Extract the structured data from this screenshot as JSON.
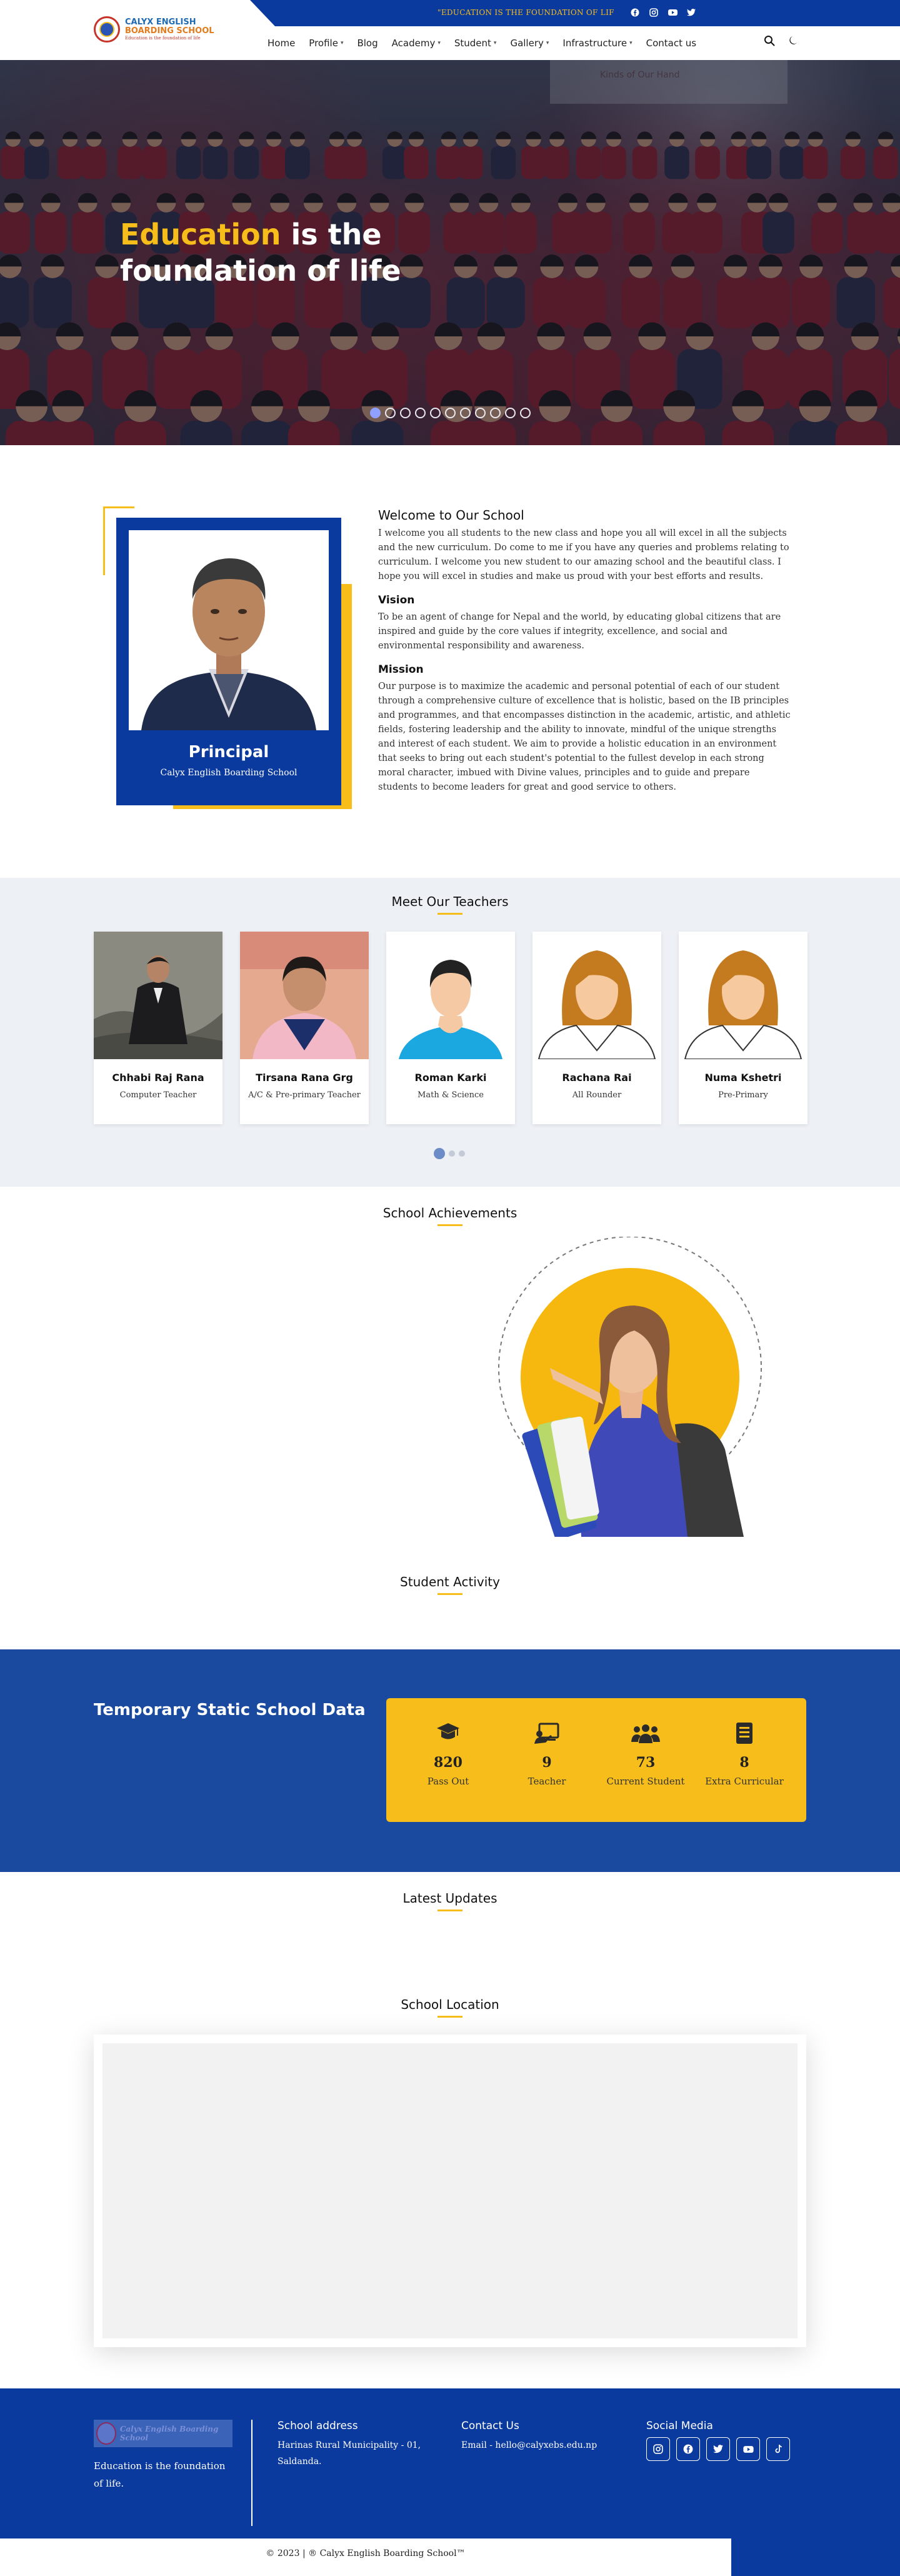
{
  "topbar": {
    "tagline": "\"EDUCATION IS THE FOUNDATION OF LIF",
    "social_icons": [
      "facebook-icon",
      "instagram-icon",
      "youtube-icon",
      "twitter-icon"
    ]
  },
  "header": {
    "logo_line1": "CALYX ENGLISH",
    "logo_line2": "BOARDING SCHOOL",
    "logo_line3": "Education is the foundation of life",
    "nav": [
      {
        "label": "Home",
        "dropdown": false
      },
      {
        "label": "Profile",
        "dropdown": true
      },
      {
        "label": "Blog",
        "dropdown": false
      },
      {
        "label": "Academy",
        "dropdown": true
      },
      {
        "label": "Student",
        "dropdown": true
      },
      {
        "label": "Gallery",
        "dropdown": true
      },
      {
        "label": "Infrastructure",
        "dropdown": true
      },
      {
        "label": "Contact us",
        "dropdown": false
      }
    ],
    "icons": [
      "search-icon",
      "dark-mode-icon"
    ]
  },
  "hero": {
    "title_accent": "Education",
    "title_rest_1": " is the",
    "title_line2": "foundation of life",
    "slide_count": 11,
    "active_slide": 0,
    "sign_text": "Kinds of Our Hand"
  },
  "welcome": {
    "principal_title": "Principal",
    "principal_subtitle": "Calyx English Boarding School",
    "heading": "Welcome to Our School",
    "intro": "I welcome you all students to the new class and hope you all will excel in all the subjects and the new curriculum. Do come to me if you have any queries and problems relating to curriculum. I welcome you new student to our amazing school and the beautiful class. I hope you will excel in studies and make us proud with your best efforts and results.",
    "vision_heading": "Vision",
    "vision_text": "To be an agent of change for Nepal and the world, by educating global citizens that are inspired and guide by the core values if integrity, excellence, and social and environmental responsibility and awareness.",
    "mission_heading": "Mission",
    "mission_text": "Our purpose is to maximize the academic and personal potential of each of our student through a comprehensive culture of excellence that is holistic, based on the IB principles and programmes, and that encompasses distinction in the academic, artistic, and athletic fields, fostering leadership and the ability to innovate, mindful of the unique strengths and interest of each student. We aim to provide a holistic education in an environment that seeks to bring out each student's potential to the fullest develop in each strong moral character, imbued with Divine values, principles and to guide and prepare students to become leaders for great and good service to others."
  },
  "teachers": {
    "title": "Meet Our Teachers",
    "list": [
      {
        "name": "Chhabi Raj Rana",
        "role": "Computer Teacher",
        "photo": "photo-male"
      },
      {
        "name": "Tirsana Rana Grg",
        "role": "A/C & Pre-primary Teacher",
        "photo": "photo-female"
      },
      {
        "name": "Roman Karki",
        "role": "Math & Science",
        "photo": "avatar-male"
      },
      {
        "name": "Rachana Rai",
        "role": "All Rounder",
        "photo": "avatar-female"
      },
      {
        "name": "Numa Kshetri",
        "role": "Pre-Primary",
        "photo": "avatar-female"
      }
    ],
    "page_count": 3,
    "active_page": 0
  },
  "achievements": {
    "title": "School Achievements"
  },
  "activity": {
    "title": "Student Activity"
  },
  "stats": {
    "title": "Temporary Static School Data",
    "items": [
      {
        "value": "820",
        "label": "Pass Out",
        "icon": "graduation-cap-icon"
      },
      {
        "value": "9",
        "label": "Teacher",
        "icon": "teacher-board-icon"
      },
      {
        "value": "73",
        "label": "Current Student",
        "icon": "users-icon"
      },
      {
        "value": "8",
        "label": "Extra Curricular",
        "icon": "document-list-icon"
      }
    ]
  },
  "updates": {
    "title": "Latest Updates"
  },
  "location": {
    "title": "School Location"
  },
  "footer": {
    "logo_text": "Calyx English Boarding School",
    "tagline": "Education is the foundation of life.",
    "address_heading": "School address",
    "address": "Harinas Rural Municipality - 01, Saldanda.",
    "contact_heading": "Contact Us",
    "email": "Email - hello@calyxebs.edu.np",
    "social_heading": "Social Media",
    "social_icons": [
      "instagram-icon",
      "facebook-icon",
      "twitter-icon",
      "youtube-icon",
      "tiktok-icon"
    ],
    "copyright": "© 2023 | ® Calyx English Boarding School™"
  },
  "colors": {
    "primary": "#0b3a9e",
    "accent": "#f6bd1b",
    "stats_bg": "#1a4aa0"
  }
}
